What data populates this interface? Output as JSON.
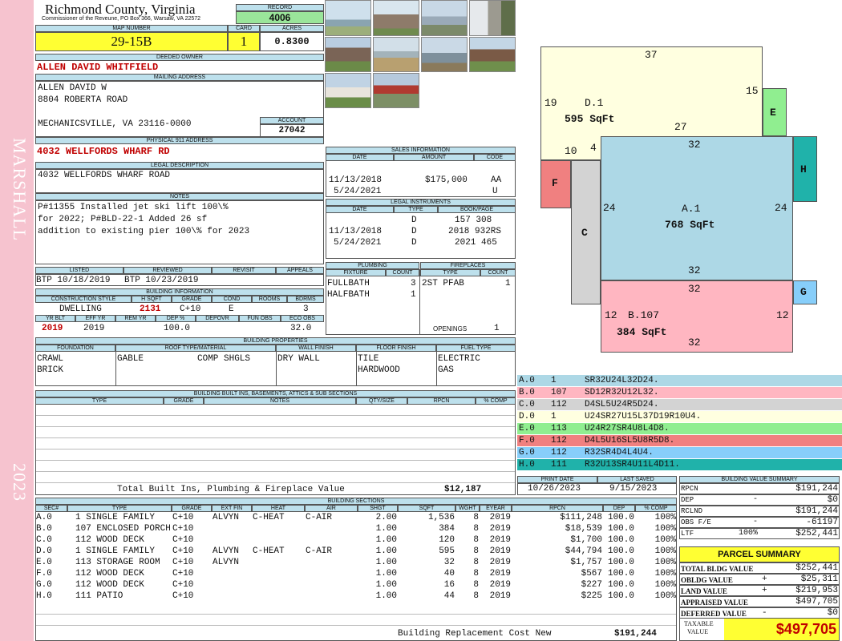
{
  "header": {
    "county": "Richmond County, Virginia",
    "commissioner": "Commissioner of the Reveune, PO Box 366, Warsaw, VA 22572",
    "record_label": "RECORD",
    "record": "4006",
    "map_label": "MAP NUMBER",
    "map_number": "29-15B",
    "card_label": "CARD",
    "card": "1",
    "acres_label": "ACRES",
    "acres": "0.8300"
  },
  "side": {
    "name": "MARSHALL",
    "year": "2023"
  },
  "owner": {
    "label": "DEEDED OWNER",
    "name": "ALLEN DAVID WHITFIELD"
  },
  "mailing": {
    "label": "MAILING ADDRESS",
    "line1": "ALLEN DAVID W",
    "line2": "8804 ROBERTA ROAD",
    "line3": "MECHANICSVILLE, VA 23116-0000",
    "account_label": "ACCOUNT",
    "account": "27042"
  },
  "physical": {
    "label": "PHYSICAL 911 ADDRESS",
    "address": "4032 WELLFORDS WHARF RD"
  },
  "legal": {
    "label": "LEGAL DESCRIPTION",
    "text": "4032 WELLFORDS WHARF ROAD"
  },
  "notes": {
    "label": "NOTES",
    "line1": "P#11355 Installed jet ski lift 100\\%",
    "line2": "for 2022; P#BLD-22-1 Added 26 sf",
    "line3": "addition to existing pier 100\\% for 2023"
  },
  "sales": {
    "label": "SALES INFORMATION",
    "cols": [
      "DATE",
      "AMOUNT",
      "CODE"
    ],
    "rows": [
      {
        "date": "11/13/2018",
        "amount": "$175,000",
        "code": "AA"
      },
      {
        "date": "5/24/2021",
        "amount": "",
        "code": "U"
      }
    ]
  },
  "instruments": {
    "label": "LEGAL INSTRUMENTS",
    "cols": [
      "DATE",
      "TYPE",
      "BOOK/PAGE"
    ],
    "rows": [
      {
        "date": "",
        "type": "D",
        "book": "157 308"
      },
      {
        "date": "11/13/2018",
        "type": "D",
        "book": "2018 932RS"
      },
      {
        "date": "5/24/2021",
        "type": "D",
        "book": "2021 465"
      }
    ]
  },
  "review": {
    "cols": [
      "LISTED",
      "REVIEWED",
      "REVISIT",
      "APPEALS"
    ],
    "listed": "BTP 10/18/2019",
    "reviewed": "BTP 10/23/2019",
    "revisit": "",
    "appeals": ""
  },
  "building_info": {
    "label": "BUILDING INFORMATION",
    "cols": [
      "CONSTRUCTION STYLE",
      "H SQFT",
      "GRADE",
      "COND",
      "ROOMS",
      "BDRMS"
    ],
    "style": "DWELLING",
    "hsqft": "2131",
    "grade": "C+10",
    "cond": "E",
    "rooms": "",
    "bdrms": "3",
    "cols2": [
      "YR BLT",
      "EFF YR",
      "REM YR",
      "DEP %",
      "DEPOVR",
      "FUN OBS",
      "ECO OBS"
    ],
    "yrblt": "2019",
    "effyr": "2019",
    "remyr": "",
    "dep": "100.0",
    "depovr": "",
    "funobs": "",
    "ecoobs": "32.0"
  },
  "plumbing": {
    "label": "PLUMBING",
    "cols": [
      "FIXTURE",
      "COUNT"
    ],
    "rows": [
      {
        "fixture": "FULLBATH",
        "count": "3"
      },
      {
        "fixture": "HALFBATH",
        "count": "1"
      }
    ]
  },
  "fireplaces": {
    "label": "FIREPLACES",
    "cols": [
      "TYPE",
      "COUNT"
    ],
    "rows": [
      {
        "type": "2ST PFAB",
        "count": "1"
      }
    ],
    "openings_label": "OPENINGS",
    "openings": "1"
  },
  "properties": {
    "label": "BUILDING PROPERTIES",
    "cols": [
      "FOUNDATION",
      "ROOF TYPE/MATERIAL",
      "WALL FINISH",
      "FLOOR FINISH",
      "FUEL TYPE"
    ],
    "foundation": [
      "CRAWL",
      "BRICK"
    ],
    "roof_type": "GABLE",
    "roof_material": "COMP SHGLS",
    "wall": "DRY WALL",
    "floor": [
      "TILE",
      "HARDWOOD"
    ],
    "fuel": [
      "ELECTRIC",
      "GAS"
    ]
  },
  "builtins": {
    "label": "BUILDING BUILT INS, BASEMENTS, ATTICS & SUB SECTIONS",
    "cols": [
      "TYPE",
      "GRADE",
      "NOTES",
      "QTY/SIZE",
      "RPCN",
      "% COMP"
    ],
    "total_label": "Total Built Ins, Plumbing & Fireplace Value",
    "total": "$12,187"
  },
  "sketch": {
    "labels": [
      {
        "code": "A.0",
        "num": "1",
        "vec": "SR32U24L32D24.",
        "color": "#add8e6"
      },
      {
        "code": "B.0",
        "num": "107",
        "vec": "SD12R32U12L32.",
        "color": "#ffb6c1"
      },
      {
        "code": "C.0",
        "num": "112",
        "vec": "D4SL5U24R5D24.",
        "color": "#d3d3d3"
      },
      {
        "code": "D.0",
        "num": "1",
        "vec": "U24SR27U15L37D19R10U4.",
        "color": "#ffffe0"
      },
      {
        "code": "E.0",
        "num": "113",
        "vec": "U24R27SR4U8L4D8.",
        "color": "#90ee90"
      },
      {
        "code": "F.0",
        "num": "112",
        "vec": "D4L5U16SL5U8R5D8.",
        "color": "#f08080"
      },
      {
        "code": "G.0",
        "num": "112",
        "vec": "R32SR4D4L4U4.",
        "color": "#87cefa"
      },
      {
        "code": "H.0",
        "num": "111",
        "vec": "R32U13SR4U11L4D11.",
        "color": "#20b2aa"
      }
    ],
    "a_name": "A.1",
    "a_area": "768 SqFt",
    "b_name": "B.107",
    "b_area": "384 SqFt",
    "d_name": "D.1",
    "d_area": "595 SqFt",
    "e": "E",
    "f": "F",
    "c": "C",
    "h": "H",
    "g": "G",
    "dims": {
      "d_top": "37",
      "d_left": "19",
      "d_right": "15",
      "d_bot": "27",
      "f_top": "10",
      "f_step": "4",
      "a_top": "32",
      "a_left": "24",
      "a_right": "24",
      "a_bot": "32",
      "b_top": "32",
      "b_left": "12",
      "b_right": "12",
      "b_bot": "32"
    }
  },
  "print": {
    "print_label": "PRINT DATE",
    "print_date": "10/26/2023",
    "saved_label": "LAST SAVED",
    "saved": "9/15/2023"
  },
  "sections": {
    "label": "BUILDING SECTIONS",
    "cols": [
      "SEC#",
      "TYPE",
      "GRADE",
      "EXT FIN",
      "HEAT",
      "AIR",
      "SHGT",
      "SQFT",
      "WGHT",
      "EYEAR",
      "RPCN",
      "DEP",
      "% COMP"
    ],
    "rows": [
      {
        "sec": "A.0",
        "type": "1 SINGLE FAMILY",
        "grade": "C+10",
        "ext": "ALVYN",
        "heat": "C-HEAT",
        "air": "C-AIR",
        "shgt": "2.00",
        "sqft": "1,536",
        "wght": "8",
        "eyear": "2019",
        "rpcn": "$111,248",
        "dep": "100.0",
        "comp": "100%"
      },
      {
        "sec": "B.0",
        "type": "107 ENCLOSED PORCH",
        "grade": "C+10",
        "ext": "",
        "heat": "",
        "air": "",
        "shgt": "1.00",
        "sqft": "384",
        "wght": "8",
        "eyear": "2019",
        "rpcn": "$18,539",
        "dep": "100.0",
        "comp": "100%"
      },
      {
        "sec": "C.0",
        "type": "112 WOOD DECK",
        "grade": "C+10",
        "ext": "",
        "heat": "",
        "air": "",
        "shgt": "1.00",
        "sqft": "120",
        "wght": "8",
        "eyear": "2019",
        "rpcn": "$1,700",
        "dep": "100.0",
        "comp": "100%"
      },
      {
        "sec": "D.0",
        "type": "1 SINGLE FAMILY",
        "grade": "C+10",
        "ext": "ALVYN",
        "heat": "C-HEAT",
        "air": "C-AIR",
        "shgt": "1.00",
        "sqft": "595",
        "wght": "8",
        "eyear": "2019",
        "rpcn": "$44,794",
        "dep": "100.0",
        "comp": "100%"
      },
      {
        "sec": "E.0",
        "type": "113 STORAGE ROOM",
        "grade": "C+10",
        "ext": "ALVYN",
        "heat": "",
        "air": "",
        "shgt": "1.00",
        "sqft": "32",
        "wght": "8",
        "eyear": "2019",
        "rpcn": "$1,757",
        "dep": "100.0",
        "comp": "100%"
      },
      {
        "sec": "F.0",
        "type": "112 WOOD DECK",
        "grade": "C+10",
        "ext": "",
        "heat": "",
        "air": "",
        "shgt": "1.00",
        "sqft": "40",
        "wght": "8",
        "eyear": "2019",
        "rpcn": "$567",
        "dep": "100.0",
        "comp": "100%"
      },
      {
        "sec": "G.0",
        "type": "112 WOOD DECK",
        "grade": "C+10",
        "ext": "",
        "heat": "",
        "air": "",
        "shgt": "1.00",
        "sqft": "16",
        "wght": "8",
        "eyear": "2019",
        "rpcn": "$227",
        "dep": "100.0",
        "comp": "100%"
      },
      {
        "sec": "H.0",
        "type": "111 PATIO",
        "grade": "C+10",
        "ext": "",
        "heat": "",
        "air": "",
        "shgt": "1.00",
        "sqft": "44",
        "wght": "8",
        "eyear": "2019",
        "rpcn": "$225",
        "dep": "100.0",
        "comp": "100%"
      }
    ],
    "total_label": "Building Replacement Cost New",
    "total": "$191,244"
  },
  "value_summary": {
    "label": "BUILDING VALUE SUMMARY",
    "rows": [
      {
        "k": "RPCN",
        "op": "",
        "v": "$191,244"
      },
      {
        "k": "DEP",
        "op": "-",
        "v": "$0"
      },
      {
        "k": "RCLND",
        "op": "",
        "v": "$191,244"
      },
      {
        "k": "OBS F/E",
        "op": "-",
        "v": "-61197"
      },
      {
        "k": "LTF",
        "op": "100%",
        "v": "$252,441"
      }
    ]
  },
  "parcel": {
    "label": "PARCEL SUMMARY",
    "rows": [
      {
        "k": "TOTAL BLDG VALUE",
        "op": "",
        "v": "$252,441"
      },
      {
        "k": "OBLDG VALUE",
        "op": "+",
        "v": "$25,311"
      },
      {
        "k": "LAND VALUE",
        "op": "+",
        "v": "$219,953"
      },
      {
        "k": "APPRAISED VALUE",
        "op": "",
        "v": "$497,705"
      },
      {
        "k": "DEFERRED VALUE",
        "op": "-",
        "v": "$0"
      }
    ],
    "taxable_label1": "TAXABLE",
    "taxable_label2": "VALUE",
    "taxable": "$497,705"
  }
}
